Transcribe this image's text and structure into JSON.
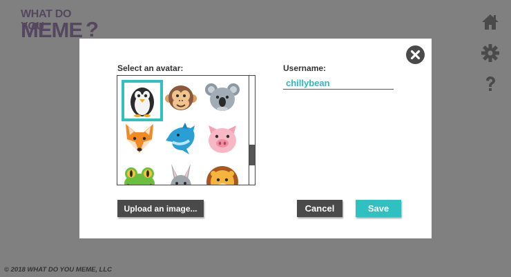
{
  "logo": {
    "line1": "WHAT DO YOU",
    "line2": "MEME",
    "mark": "?"
  },
  "nav_icons": [
    "home-icon",
    "gear-icon",
    "help-icon"
  ],
  "footer": {
    "copyright": "© 2018 WHAT DO YOU MEME, LLC"
  },
  "modal": {
    "avatar_label": "Select an avatar:",
    "username_label": "Username:",
    "username_value": "chillybean",
    "avatars": [
      "penguin",
      "monkey",
      "koala",
      "fox",
      "dolphin",
      "pig",
      "frog",
      "donkey",
      "lion"
    ],
    "selected_avatar": "penguin",
    "upload_label": "Upload an image...",
    "cancel_label": "Cancel",
    "save_label": "Save"
  },
  "colors": {
    "accent": "#2fc0c0",
    "dark_button": "#4a4a4a",
    "overlay": "#808080",
    "logo": "#50415c"
  }
}
